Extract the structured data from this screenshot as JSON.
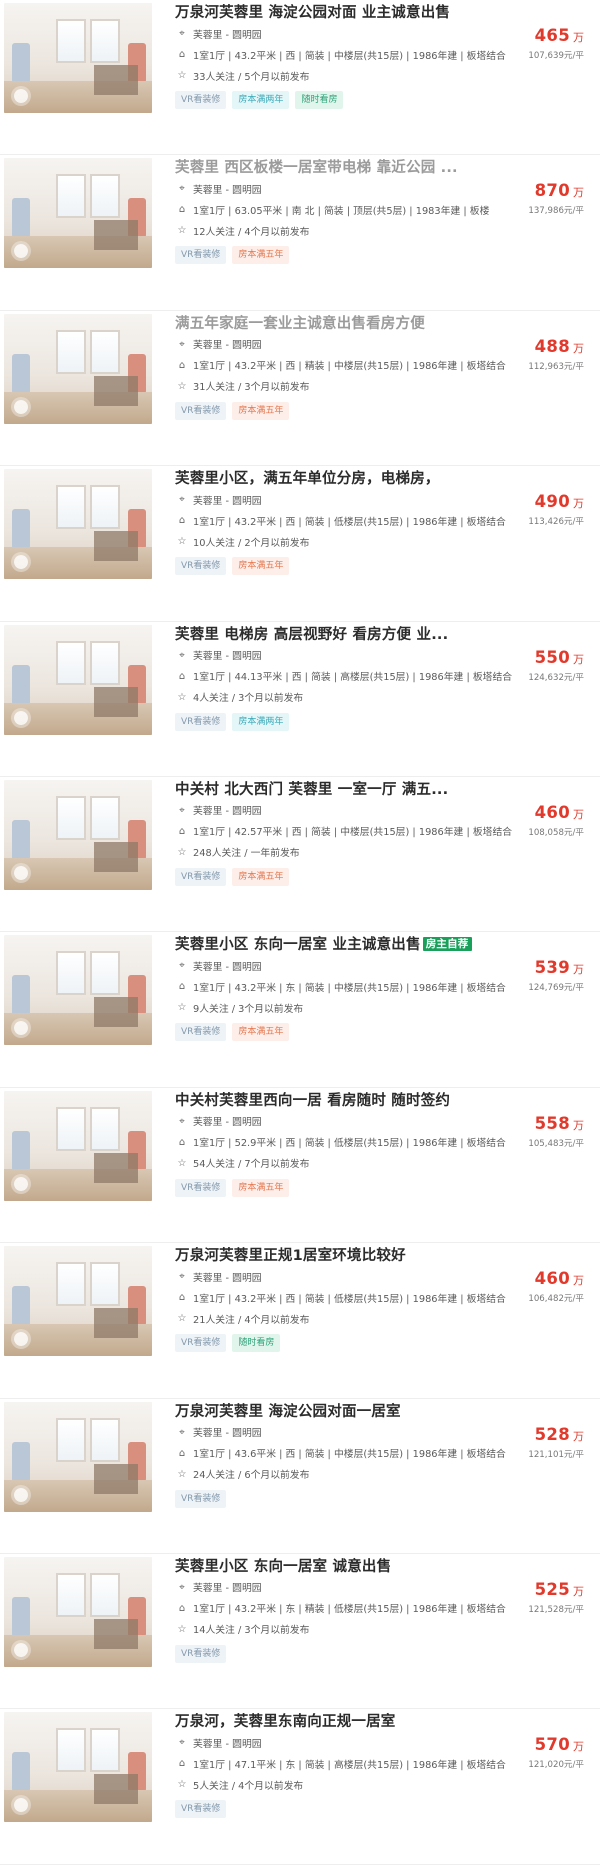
{
  "listings": [
    {
      "title": "万泉河芙蓉里 海淀公园对面 业主诚意出售",
      "visited": false,
      "badge": "",
      "community": "芙蓉里 - 圆明园",
      "details": "1室1厅 | 43.2平米 | 西 | 简装 | 中楼层(共15层) | 1986年建 | 板塔结合",
      "follow": "33人关注 / 5个月以前发布",
      "tags": [
        {
          "label": "VR看装修",
          "color": "vr"
        },
        {
          "label": "房本满两年",
          "color": "cyan"
        },
        {
          "label": "随时看房",
          "color": "green"
        }
      ],
      "total": "465",
      "unit_wan": "万",
      "per": "107,639元/平"
    },
    {
      "title": "芙蓉里 西区板楼一居室带电梯 靠近公园 ...",
      "visited": true,
      "badge": "",
      "community": "芙蓉里 - 圆明园",
      "details": "1室1厅 | 63.05平米 | 南 北 | 简装 | 顶层(共5层) | 1983年建 | 板楼",
      "follow": "12人关注 / 4个月以前发布",
      "tags": [
        {
          "label": "VR看装修",
          "color": "vr"
        },
        {
          "label": "房本满五年",
          "color": "red"
        }
      ],
      "total": "870",
      "unit_wan": "万",
      "per": "137,986元/平"
    },
    {
      "title": "满五年家庭一套业主诚意出售看房方便",
      "visited": true,
      "badge": "",
      "community": "芙蓉里 - 圆明园",
      "details": "1室1厅 | 43.2平米 | 西 | 精装 | 中楼层(共15层) | 1986年建 | 板塔结合",
      "follow": "31人关注 / 3个月以前发布",
      "tags": [
        {
          "label": "VR看装修",
          "color": "vr"
        },
        {
          "label": "房本满五年",
          "color": "red"
        }
      ],
      "total": "488",
      "unit_wan": "万",
      "per": "112,963元/平"
    },
    {
      "title": "芙蓉里小区，满五年单位分房，电梯房，",
      "visited": false,
      "badge": "",
      "community": "芙蓉里 - 圆明园",
      "details": "1室1厅 | 43.2平米 | 西 | 简装 | 低楼层(共15层) | 1986年建 | 板塔结合",
      "follow": "10人关注 / 2个月以前发布",
      "tags": [
        {
          "label": "VR看装修",
          "color": "vr"
        },
        {
          "label": "房本满五年",
          "color": "red"
        }
      ],
      "total": "490",
      "unit_wan": "万",
      "per": "113,426元/平"
    },
    {
      "title": "芙蓉里 电梯房 高层视野好 看房方便 业...",
      "visited": false,
      "badge": "",
      "community": "芙蓉里 - 圆明园",
      "details": "1室1厅 | 44.13平米 | 西 | 简装 | 高楼层(共15层) | 1986年建 | 板塔结合",
      "follow": "4人关注 / 3个月以前发布",
      "tags": [
        {
          "label": "VR看装修",
          "color": "vr"
        },
        {
          "label": "房本满两年",
          "color": "cyan"
        }
      ],
      "total": "550",
      "unit_wan": "万",
      "per": "124,632元/平"
    },
    {
      "title": "中关村 北大西门 芙蓉里 一室一厅 满五...",
      "visited": false,
      "badge": "",
      "community": "芙蓉里 - 圆明园",
      "details": "1室1厅 | 42.57平米 | 西 | 简装 | 中楼层(共15层) | 1986年建 | 板塔结合",
      "follow": "248人关注 / 一年前发布",
      "tags": [
        {
          "label": "VR看装修",
          "color": "vr"
        },
        {
          "label": "房本满五年",
          "color": "red"
        }
      ],
      "total": "460",
      "unit_wan": "万",
      "per": "108,058元/平"
    },
    {
      "title": "芙蓉里小区 东向一居室 业主诚意出售",
      "visited": false,
      "badge": "房主自荐",
      "community": "芙蓉里 - 圆明园",
      "details": "1室1厅 | 43.2平米 | 东 | 简装 | 中楼层(共15层) | 1986年建 | 板塔结合",
      "follow": "9人关注 / 3个月以前发布",
      "tags": [
        {
          "label": "VR看装修",
          "color": "vr"
        },
        {
          "label": "房本满五年",
          "color": "red"
        }
      ],
      "total": "539",
      "unit_wan": "万",
      "per": "124,769元/平"
    },
    {
      "title": "中关村芙蓉里西向一居 看房随时 随时签约",
      "visited": false,
      "badge": "",
      "community": "芙蓉里 - 圆明园",
      "details": "1室1厅 | 52.9平米 | 西 | 简装 | 低楼层(共15层) | 1986年建 | 板塔结合",
      "follow": "54人关注 / 7个月以前发布",
      "tags": [
        {
          "label": "VR看装修",
          "color": "vr"
        },
        {
          "label": "房本满五年",
          "color": "red"
        }
      ],
      "total": "558",
      "unit_wan": "万",
      "per": "105,483元/平"
    },
    {
      "title": "万泉河芙蓉里正规1居室环境比较好",
      "visited": false,
      "badge": "",
      "community": "芙蓉里 - 圆明园",
      "details": "1室1厅 | 43.2平米 | 西 | 简装 | 低楼层(共15层) | 1986年建 | 板塔结合",
      "follow": "21人关注 / 4个月以前发布",
      "tags": [
        {
          "label": "VR看装修",
          "color": "vr"
        },
        {
          "label": "随时看房",
          "color": "green"
        }
      ],
      "total": "460",
      "unit_wan": "万",
      "per": "106,482元/平"
    },
    {
      "title": "万泉河芙蓉里 海淀公园对面一居室",
      "visited": false,
      "badge": "",
      "community": "芙蓉里 - 圆明园",
      "details": "1室1厅 | 43.6平米 | 西 | 简装 | 中楼层(共15层) | 1986年建 | 板塔结合",
      "follow": "24人关注 / 6个月以前发布",
      "tags": [
        {
          "label": "VR看装修",
          "color": "vr"
        }
      ],
      "total": "528",
      "unit_wan": "万",
      "per": "121,101元/平"
    },
    {
      "title": "芙蓉里小区 东向一居室 诚意出售",
      "visited": false,
      "badge": "",
      "community": "芙蓉里 - 圆明园",
      "details": "1室1厅 | 43.2平米 | 东 | 精装 | 低楼层(共15层) | 1986年建 | 板塔结合",
      "follow": "14人关注 / 3个月以前发布",
      "tags": [
        {
          "label": "VR看装修",
          "color": "vr"
        }
      ],
      "total": "525",
      "unit_wan": "万",
      "per": "121,528元/平"
    },
    {
      "title": "万泉河，芙蓉里东南向正规一居室",
      "visited": false,
      "badge": "",
      "community": "芙蓉里 - 圆明园",
      "details": "1室1厅 | 47.1平米 | 东 | 简装 | 高楼层(共15层) | 1986年建 | 板塔结合",
      "follow": "5人关注 / 4个月以前发布",
      "tags": [
        {
          "label": "VR看装修",
          "color": "vr"
        }
      ],
      "total": "570",
      "unit_wan": "万",
      "per": "121,020元/平"
    }
  ]
}
